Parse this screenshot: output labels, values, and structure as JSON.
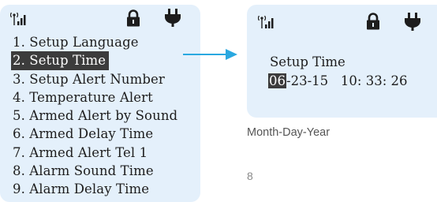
{
  "left_screen": {
    "icons": [
      "signal-icon",
      "lock-icon",
      "power-plug-icon"
    ],
    "menu_items": [
      "1. Setup Language",
      "2. Setup Time",
      "3. Setup Alert Number",
      "4. Temperature Alert",
      "5. Armed Alert by Sound",
      "6. Armed Delay Time",
      "7. Armed Alert Tel 1",
      "8. Alarm Sound Time",
      "9. Alarm Delay Time"
    ],
    "selected_index": 1
  },
  "right_screen": {
    "icons": [
      "signal-icon",
      "lock-icon",
      "power-plug-icon"
    ],
    "title": "Setup Time",
    "date_highlight": "06",
    "date_rest": "-23-15",
    "time": "10: 33: 26"
  },
  "caption": "Month-Day-Year",
  "page_number": "8",
  "colors": {
    "screen_bg": "#e4f0fb",
    "arrow": "#2aa8e0",
    "highlight_bg": "#3c3c3c",
    "text": "#1d1d1d"
  }
}
